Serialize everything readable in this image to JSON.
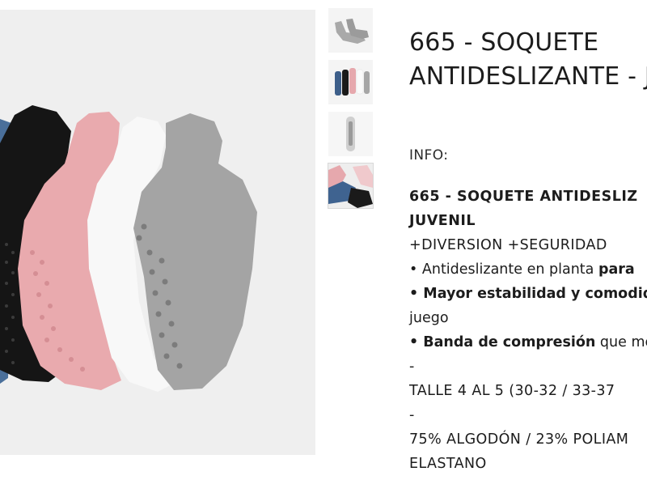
{
  "product": {
    "title_line1": "665 - SOQUETE",
    "title_line2": "ANTIDESLIZANTE - J"
  },
  "gallery": {
    "main_image": "socks-fan-photo",
    "thumbnails": [
      {
        "image": "gray-sock-pair"
      },
      {
        "image": "socks-color-set"
      },
      {
        "image": "sock-sole-grip"
      },
      {
        "image": "socks-fan-photo"
      }
    ],
    "selected_index": 3
  },
  "info": {
    "heading": "INFO:",
    "name_line1": "665 - SOQUETE ANTIDESLIZ",
    "name_line2": "JUVENIL",
    "tagline": "+DIVERSION +SEGURIDAD",
    "bullet1_prefix": "•  Antideslizante en planta ",
    "bullet1_bold": "para",
    "bullet2_bold": "• Mayor estabilidad y comodida",
    "bullet2_cont": "juego",
    "bullet3_bold": "• Banda de compresión",
    "bullet3_rest": " que me",
    "sep1": "-",
    "size": " TALLE 4 AL 5 (30-32 / 33-37",
    "sep2": "-",
    "material_line1": "75% ALGODÓN / 23% POLIAM",
    "material_line2": "ELASTANO"
  },
  "colors": {
    "sock_blue": "#4a6f9a",
    "sock_black": "#141414",
    "sock_pink": "#e8a9ad",
    "sock_white": "#f7f7f7",
    "sock_gray": "#a3a3a3",
    "background": "#efefef"
  }
}
